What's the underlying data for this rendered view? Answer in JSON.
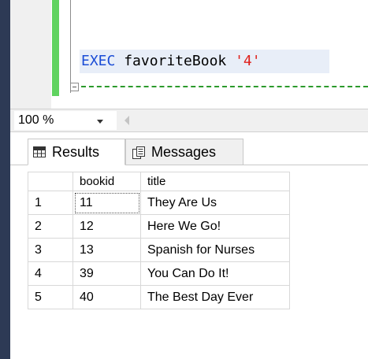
{
  "editor": {
    "keyword": "EXEC",
    "procedure": "favoriteBook",
    "argument": "'4'"
  },
  "zoom": {
    "value": "100 %"
  },
  "tabs": [
    {
      "label": "Results"
    },
    {
      "label": "Messages"
    }
  ],
  "results": {
    "columns": [
      "bookid",
      "title"
    ],
    "rows": [
      {
        "num": "1",
        "bookid": "11",
        "title": "They Are Us"
      },
      {
        "num": "2",
        "bookid": "12",
        "title": "Here We Go!"
      },
      {
        "num": "3",
        "bookid": "13",
        "title": "Spanish for Nurses"
      },
      {
        "num": "4",
        "bookid": "39",
        "title": "You Can Do It!"
      },
      {
        "num": "5",
        "bookid": "40",
        "title": "The Best Day Ever"
      }
    ]
  },
  "colors": {
    "keyword": "#1a4cd6",
    "string": "#e0201b",
    "change_bar": "#5fd35f"
  }
}
